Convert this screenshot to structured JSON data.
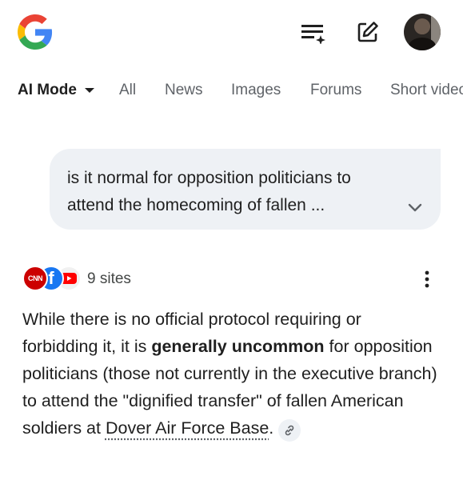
{
  "header": {
    "logo": "google-g-logo",
    "actions": [
      {
        "name": "ai-mode-history",
        "icon": "list-sparkle-icon"
      },
      {
        "name": "new-chat",
        "icon": "edit-square-icon"
      }
    ],
    "avatar": "user-avatar"
  },
  "tabs": {
    "active": "AI Mode",
    "items": [
      "All",
      "News",
      "Images",
      "Forums",
      "Short videos"
    ]
  },
  "query": {
    "text_line1": "is it normal for opposition politicians to",
    "text_line2": "attend the homecoming of fallen ...",
    "expand_icon": "chevron-down-icon"
  },
  "sources": {
    "logos": [
      "cnn-logo",
      "facebook-logo",
      "youtube-logo"
    ],
    "cnn_label": "CNN",
    "fb_label": "f",
    "count_label": "9 sites"
  },
  "answer": {
    "part1": "While there is no official protocol requiring or forbidding it, it is ",
    "bold": "generally uncommon",
    "part2": " for opposition politicians (those not currently in the executive branch) to attend the \"dignified transfer\" of fallen American soldiers at ",
    "link_text": "Dover Air Force Base",
    "part3": "."
  },
  "colors": {
    "bubble_bg": "#eef1f5",
    "text": "#1f1f1f",
    "muted": "#5f6368"
  }
}
